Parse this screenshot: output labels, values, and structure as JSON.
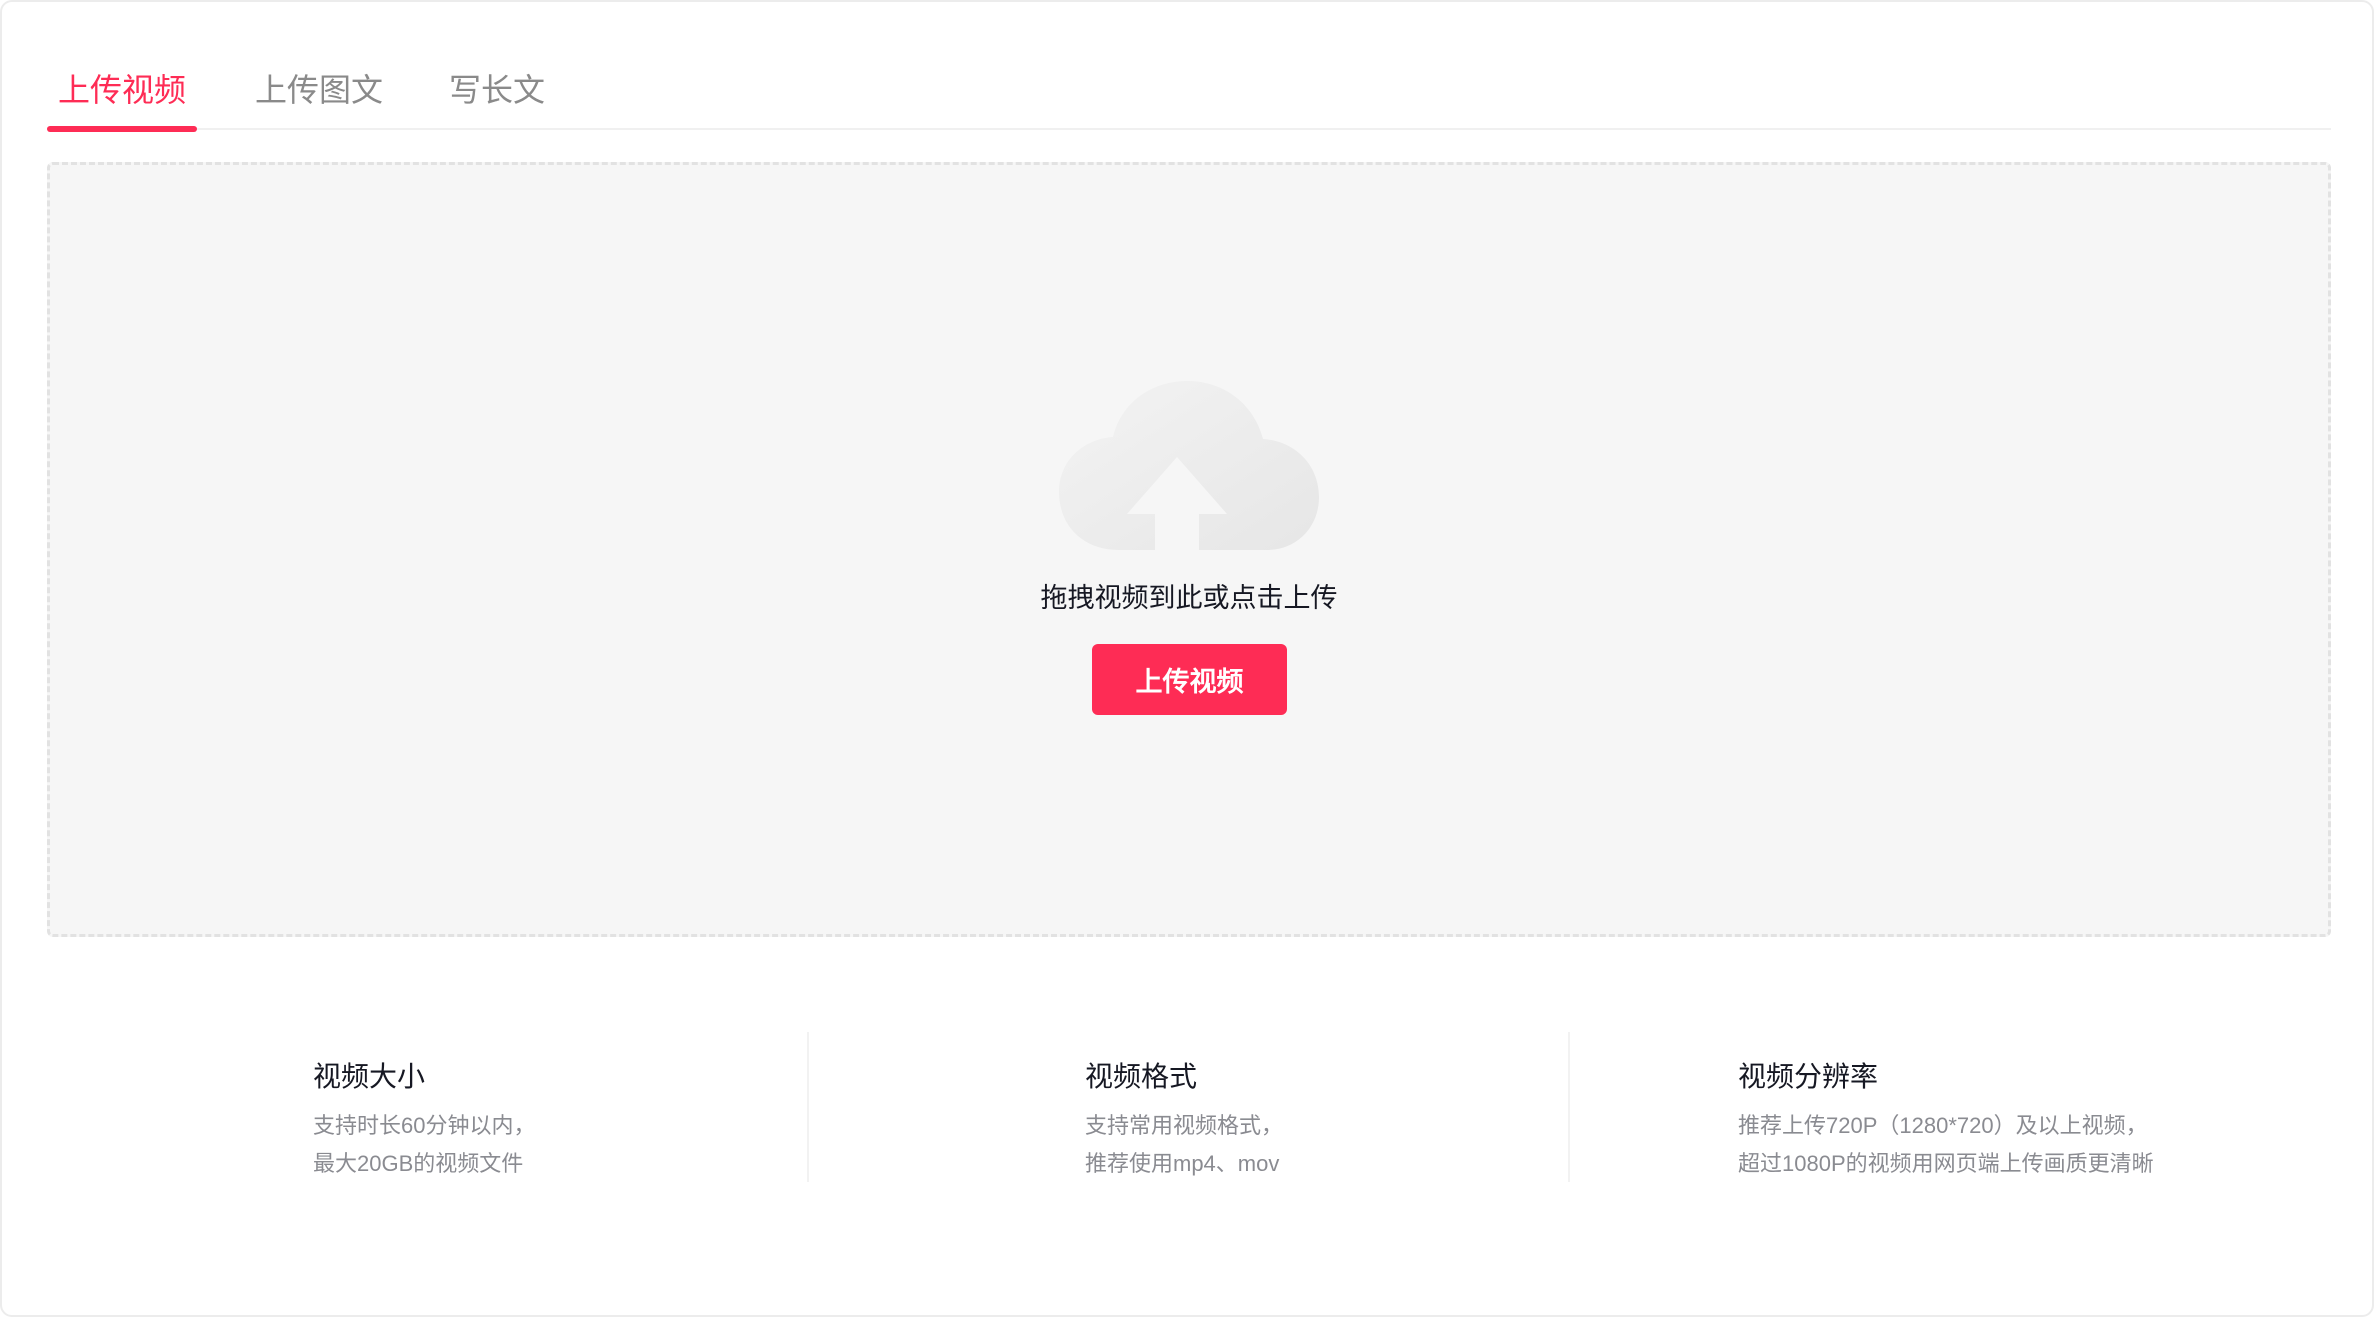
{
  "tabs": [
    {
      "label": "上传视频",
      "active": true
    },
    {
      "label": "上传图文",
      "active": false
    },
    {
      "label": "写长文",
      "active": false
    }
  ],
  "upload": {
    "icon": "cloud-upload-icon",
    "hint": "拖拽视频到此或点击上传",
    "button_label": "上传视频"
  },
  "info": [
    {
      "title": "视频大小",
      "lines": [
        "支持时长60分钟以内，",
        "最大20GB的视频文件"
      ]
    },
    {
      "title": "视频格式",
      "lines": [
        "支持常用视频格式，",
        "推荐使用mp4、mov"
      ]
    },
    {
      "title": "视频分辨率",
      "lines": [
        "推荐上传720P（1280*720）及以上视频，",
        "超过1080P的视频用网页端上传画质更清晰"
      ]
    }
  ],
  "colors": {
    "accent": "#fe2c55",
    "dropzone_bg": "#f6f6f6",
    "text_primary": "#161823",
    "text_secondary": "#8a8b91"
  }
}
